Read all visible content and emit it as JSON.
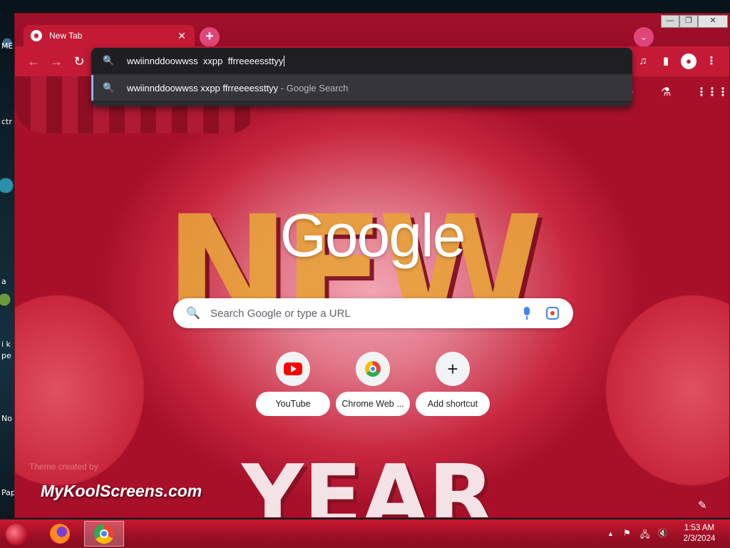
{
  "desktop": {
    "labels": [
      "ME",
      "ctr",
      "a",
      "pe",
      "i k",
      "No",
      "Pap"
    ]
  },
  "window": {
    "tab": {
      "title": "New Tab",
      "close": "✕"
    },
    "new_tab": "+",
    "tab_search": "⌄",
    "controls": {
      "minimize": "—",
      "maximize": "❐",
      "close": "✕"
    }
  },
  "toolbar": {
    "back": "←",
    "forward": "→",
    "reload": "↻",
    "media": "♫",
    "side_panel": "▮",
    "profile": "●",
    "menu": "⋮"
  },
  "omnibox": {
    "search_icon": "🔍",
    "input_value": "wwiinnddoowwss  xxpp  ffrreeeessttyy",
    "suggestion": {
      "text": "wwiinnddoowwss xxpp ffrreeeessttyy",
      "sub": " - Google Search"
    }
  },
  "ntp": {
    "images_label": "ges",
    "labs_icon": "⚗",
    "apps_icon": "⋮⋮⋮",
    "decor": {
      "new": "NEW",
      "year": "YEAR"
    },
    "logo": "Google",
    "search_placeholder": "Search Google or type a URL",
    "search_icon": "🔍",
    "shortcuts": [
      {
        "label": "YouTube"
      },
      {
        "label": "Chrome Web ..."
      },
      {
        "label": "Add shortcut",
        "icon": "+"
      }
    ],
    "theme_credit": "Theme created by",
    "theme_brand": "MyKoolScreens.com",
    "edit_icon": "✎"
  },
  "taskbar": {
    "tray": {
      "up": "▲",
      "flag": "⚑",
      "network": "🖧",
      "volume": "🔇"
    },
    "time": "1:53 AM",
    "date": "2/3/2024"
  },
  "colors": {
    "theme_primary": "#c41a36",
    "omnibox_bg": "#2b2b2f",
    "suggest_accent": "#8ab4f8"
  }
}
